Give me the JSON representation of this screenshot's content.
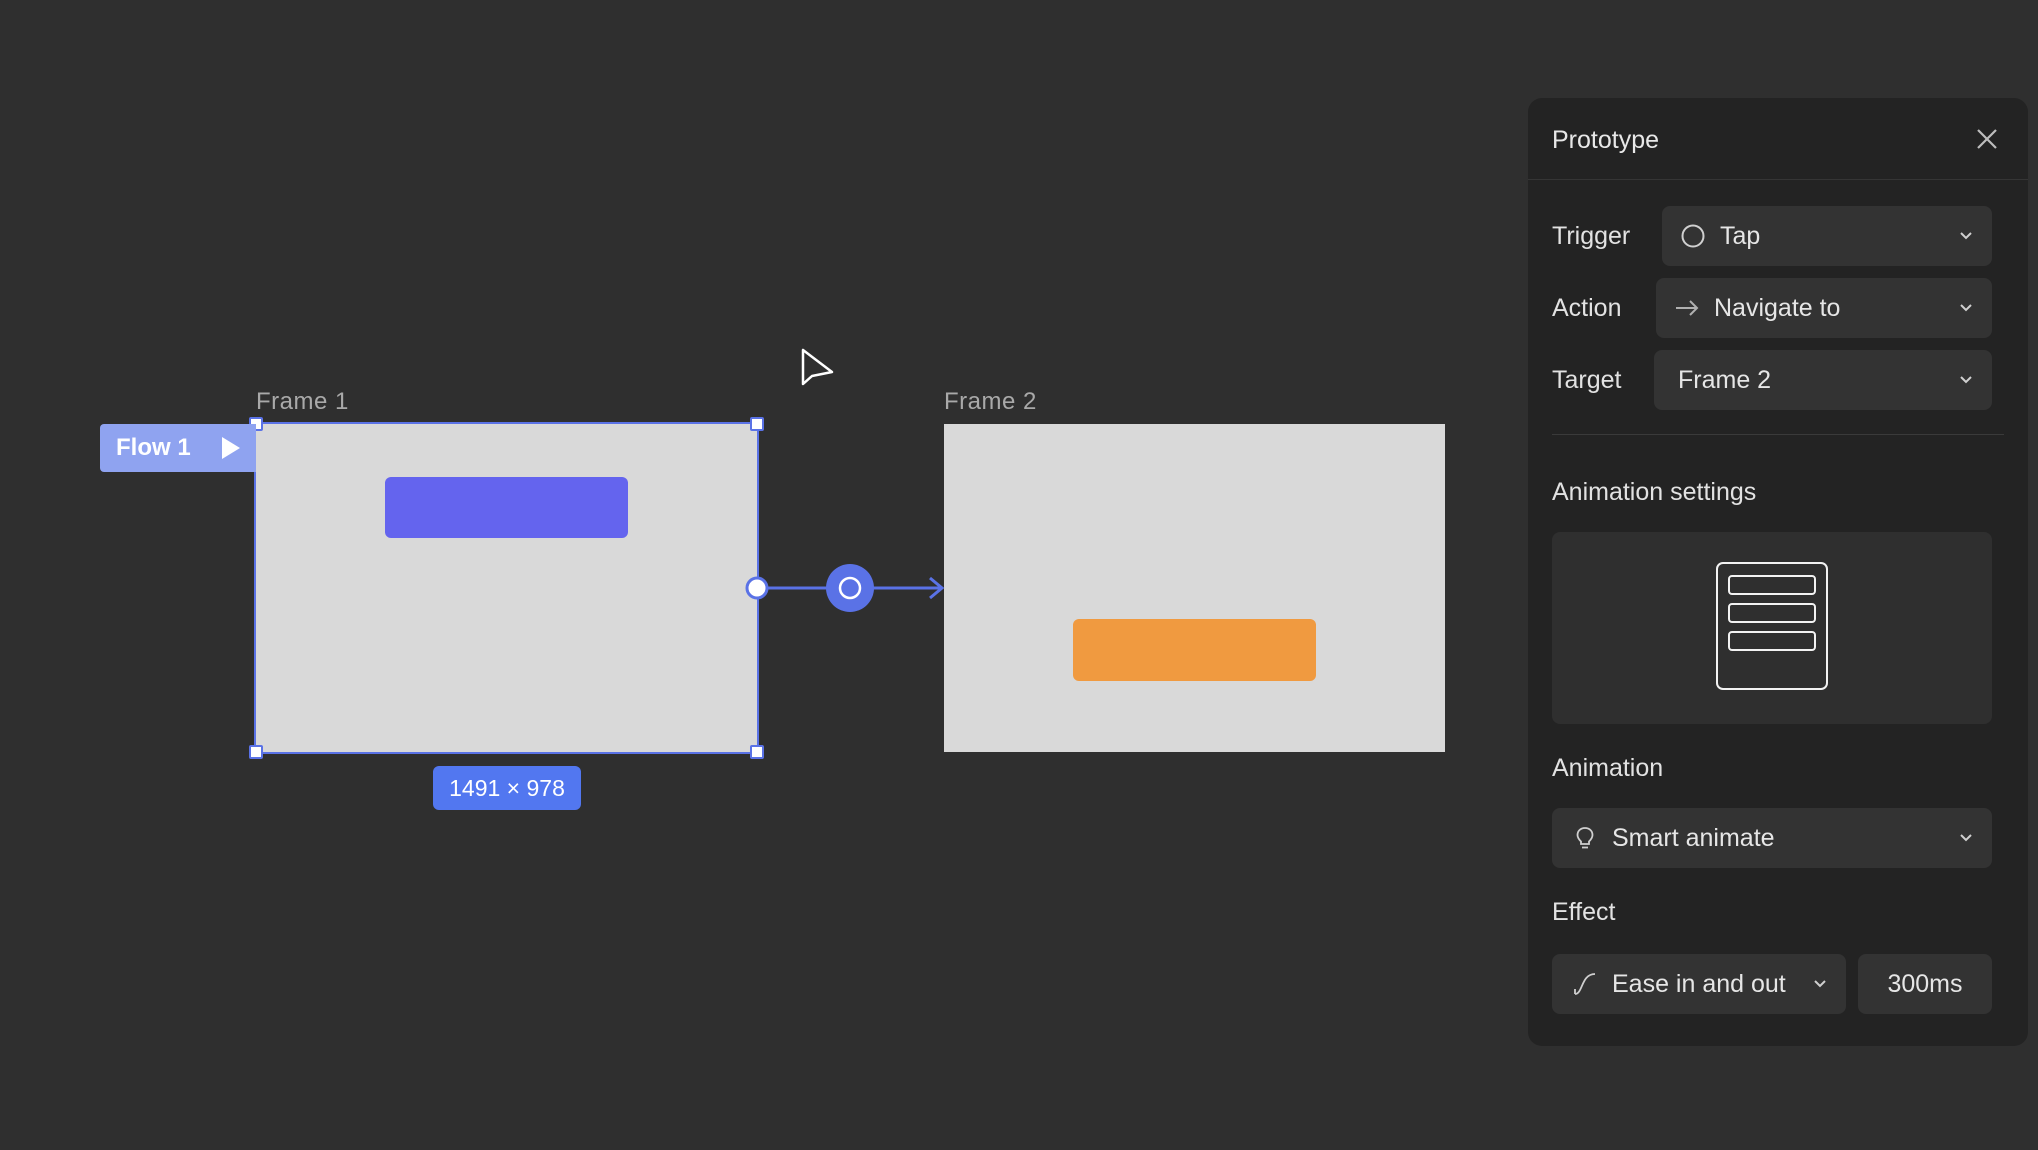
{
  "canvas": {
    "frame1": {
      "label": "Frame 1",
      "size_badge": "1491 × 978"
    },
    "frame2": {
      "label": "Frame 2"
    },
    "flow": {
      "label": "Flow 1"
    }
  },
  "panel": {
    "title": "Prototype",
    "trigger": {
      "label": "Trigger",
      "value": "Tap"
    },
    "action": {
      "label": "Action",
      "value": "Navigate to"
    },
    "target": {
      "label": "Target",
      "value": "Frame 2"
    },
    "animation_settings_title": "Animation settings",
    "animation": {
      "label": "Animation",
      "value": "Smart animate"
    },
    "effect": {
      "label": "Effect",
      "value": "Ease in and out",
      "duration": "300ms"
    }
  },
  "colors": {
    "accent": "#5a72e6",
    "frame1_button": "#6464ee",
    "frame2_button": "#f09a40",
    "frame_bg": "#d9d9d9",
    "canvas_bg": "#2f2f2f",
    "panel_bg": "#232323"
  },
  "icons": {
    "trigger": "circle-icon",
    "action": "arrow-right-icon",
    "animation": "lightbulb-icon",
    "effect": "ease-curve-icon",
    "close": "close-icon",
    "dropdown": "chevron-down-icon"
  }
}
